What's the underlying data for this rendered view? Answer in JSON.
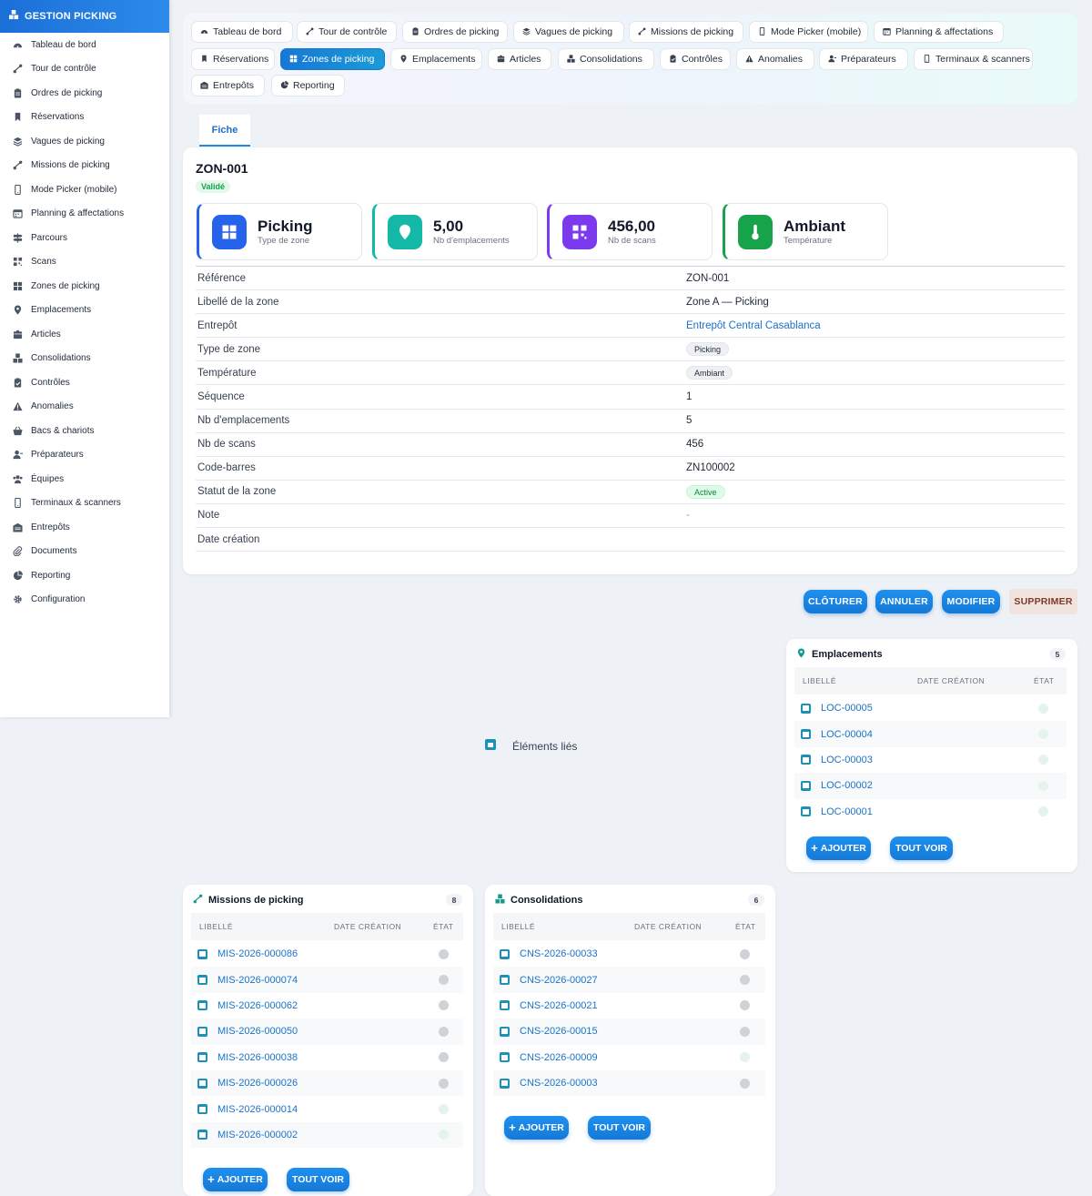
{
  "brand": {
    "title": "GESTION PICKING"
  },
  "sidebar": {
    "items": [
      {
        "label": "Tableau de bord",
        "icon": "dashboard-icon"
      },
      {
        "label": "Tour de contrôle",
        "icon": "route-icon"
      },
      {
        "label": "Ordres de picking",
        "icon": "clipboard-icon"
      },
      {
        "label": "Réservations",
        "icon": "bookmark-icon"
      },
      {
        "label": "Vagues de picking",
        "icon": "layers-icon"
      },
      {
        "label": "Missions de picking",
        "icon": "route-icon"
      },
      {
        "label": "Mode Picker (mobile)",
        "icon": "mobile-icon"
      },
      {
        "label": "Planning & affectations",
        "icon": "calendar-icon"
      },
      {
        "label": "Parcours",
        "icon": "signpost-icon"
      },
      {
        "label": "Scans",
        "icon": "qrcode-icon"
      },
      {
        "label": "Zones de picking",
        "icon": "grid-icon"
      },
      {
        "label": "Emplacements",
        "icon": "pin-icon"
      },
      {
        "label": "Articles",
        "icon": "box-icon"
      },
      {
        "label": "Consolidations",
        "icon": "boxes-icon"
      },
      {
        "label": "Contrôles",
        "icon": "clipboard-check-icon"
      },
      {
        "label": "Anomalies",
        "icon": "warning-icon"
      },
      {
        "label": "Bacs & chariots",
        "icon": "basket-icon"
      },
      {
        "label": "Préparateurs",
        "icon": "user-icon"
      },
      {
        "label": "Équipes",
        "icon": "users-icon"
      },
      {
        "label": "Terminaux & scanners",
        "icon": "mobile-icon"
      },
      {
        "label": "Entrepôts",
        "icon": "warehouse-icon"
      },
      {
        "label": "Documents",
        "icon": "paperclip-icon"
      },
      {
        "label": "Reporting",
        "icon": "pie-icon"
      },
      {
        "label": "Configuration",
        "icon": "gear-icon"
      }
    ]
  },
  "topnav": {
    "items": [
      {
        "label": "Tableau de bord",
        "icon": "dashboard-icon"
      },
      {
        "label": "Tour de contrôle",
        "icon": "route-icon"
      },
      {
        "label": "Ordres de picking",
        "icon": "clipboard-icon"
      },
      {
        "label": "Vagues de picking",
        "icon": "layers-icon"
      },
      {
        "label": "Missions de picking",
        "icon": "route-icon"
      },
      {
        "label": "Mode Picker (mobile)",
        "icon": "mobile-icon"
      },
      {
        "label": "Planning & affectations",
        "icon": "calendar-icon"
      },
      {
        "label": "Réservations",
        "icon": "bookmark-icon"
      },
      {
        "label": "Zones de picking",
        "icon": "grid-icon",
        "active": true
      },
      {
        "label": "Emplacements",
        "icon": "pin-icon"
      },
      {
        "label": "Articles",
        "icon": "box-icon"
      },
      {
        "label": "Consolidations",
        "icon": "boxes-icon"
      },
      {
        "label": "Contrôles",
        "icon": "clipboard-check-icon"
      },
      {
        "label": "Anomalies",
        "icon": "warning-icon"
      },
      {
        "label": "Préparateurs",
        "icon": "user-icon"
      },
      {
        "label": "Terminaux & scanners",
        "icon": "mobile-icon"
      },
      {
        "label": "Entrepôts",
        "icon": "warehouse-icon"
      },
      {
        "label": "Reporting",
        "icon": "pie-icon"
      }
    ]
  },
  "tab": {
    "label": "Fiche"
  },
  "record": {
    "title": "ZON-001",
    "status": "Validé",
    "kpis": [
      {
        "value": "Picking",
        "label": "Type de zone",
        "color": "#2563eb",
        "icon": "grid-icon"
      },
      {
        "value": "5,00",
        "label": "Nb d'emplacements",
        "color": "#14b8a6",
        "icon": "pin-icon"
      },
      {
        "value": "456,00",
        "label": "Nb de scans",
        "color": "#7c3aed",
        "icon": "qrcode-icon"
      },
      {
        "value": "Ambiant",
        "label": "Température",
        "color": "#16a34a",
        "icon": "thermometer-icon"
      }
    ],
    "fields": [
      {
        "label": "Référence",
        "value": "ZON-001",
        "kind": "text"
      },
      {
        "label": "Libellé de la zone",
        "value": "Zone A — Picking",
        "kind": "text"
      },
      {
        "label": "Entrepôt",
        "value": "Entrepôt Central Casablanca",
        "kind": "link"
      },
      {
        "label": "Type de zone",
        "value": "Picking",
        "kind": "chip"
      },
      {
        "label": "Température",
        "value": "Ambiant",
        "kind": "chip"
      },
      {
        "label": "Séquence",
        "value": "1",
        "kind": "text"
      },
      {
        "label": "Nb d'emplacements",
        "value": "5",
        "kind": "text"
      },
      {
        "label": "Nb de scans",
        "value": "456",
        "kind": "text"
      },
      {
        "label": "Code-barres",
        "value": "ZN100002",
        "kind": "text"
      },
      {
        "label": "Statut de la zone",
        "value": "Active",
        "kind": "chip-green"
      },
      {
        "label": "Note",
        "value": "-",
        "kind": "muted"
      },
      {
        "label": "Date création",
        "value": "",
        "kind": "text"
      }
    ]
  },
  "actions": {
    "close": "CLÔTURER",
    "cancel": "ANNULER",
    "edit": "MODIFIER",
    "delete": "SUPPRIMER"
  },
  "linked": {
    "label": "Éléments liés"
  },
  "table_headers": {
    "label": "LIBELLÉ",
    "date": "DATE CRÉATION",
    "state": "ÉTAT"
  },
  "panel_buttons": {
    "add": "AJOUTER",
    "see_all": "TOUT VOIR"
  },
  "panels": {
    "emplacements": {
      "title": "Emplacements",
      "count": "5",
      "icon": "pin-icon",
      "rows": [
        {
          "ref": "LOC-00005",
          "state": "light"
        },
        {
          "ref": "LOC-00004",
          "state": "light"
        },
        {
          "ref": "LOC-00003",
          "state": "light"
        },
        {
          "ref": "LOC-00002",
          "state": "light"
        },
        {
          "ref": "LOC-00001",
          "state": "light"
        }
      ]
    },
    "missions": {
      "title": "Missions de picking",
      "count": "8",
      "icon": "route-icon",
      "rows": [
        {
          "ref": "MIS-2026-000086",
          "state": "grey"
        },
        {
          "ref": "MIS-2026-000074",
          "state": "grey"
        },
        {
          "ref": "MIS-2026-000062",
          "state": "grey"
        },
        {
          "ref": "MIS-2026-000050",
          "state": "grey"
        },
        {
          "ref": "MIS-2026-000038",
          "state": "grey"
        },
        {
          "ref": "MIS-2026-000026",
          "state": "grey"
        },
        {
          "ref": "MIS-2026-000014",
          "state": "light"
        },
        {
          "ref": "MIS-2026-000002",
          "state": "light"
        }
      ]
    },
    "consolidations": {
      "title": "Consolidations",
      "count": "6",
      "icon": "boxes-icon",
      "rows": [
        {
          "ref": "CNS-2026-00033",
          "state": "grey"
        },
        {
          "ref": "CNS-2026-00027",
          "state": "grey"
        },
        {
          "ref": "CNS-2026-00021",
          "state": "grey"
        },
        {
          "ref": "CNS-2026-00015",
          "state": "grey"
        },
        {
          "ref": "CNS-2026-00009",
          "state": "light"
        },
        {
          "ref": "CNS-2026-00003",
          "state": "grey"
        }
      ]
    }
  }
}
